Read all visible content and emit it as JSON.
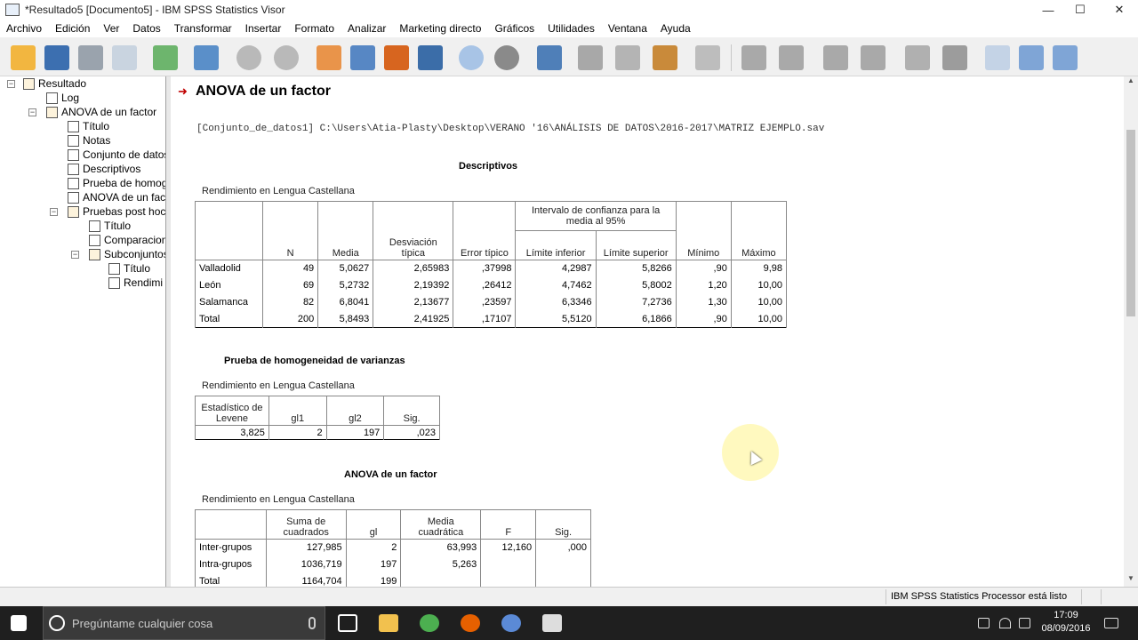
{
  "window": {
    "title": "*Resultado5 [Documento5] - IBM SPSS Statistics Visor",
    "minimize": "—",
    "maximize": "☐",
    "close": "✕"
  },
  "menu": [
    "Archivo",
    "Edición",
    "Ver",
    "Datos",
    "Transformar",
    "Insertar",
    "Formato",
    "Analizar",
    "Marketing directo",
    "Gráficos",
    "Utilidades",
    "Ventana",
    "Ayuda"
  ],
  "toolbar_icons": [
    "open-icon",
    "save-icon",
    "print-icon",
    "print-preview-icon",
    "export-icon",
    "recall-dialog-icon",
    "undo-icon",
    "redo-icon",
    "goto-data-icon",
    "goto-case-icon",
    "goto-variable-icon",
    "variables-icon",
    "analysis-icon",
    "chart-icon",
    "select-cases-icon",
    "designate-window-icon",
    "cut-icon",
    "copy-icon",
    "paste-icon",
    "text-icon",
    "back-arrow-icon",
    "forward-arrow-icon",
    "expand-icon",
    "collapse-icon",
    "show-icon",
    "hide-icon",
    "insert-heading-icon",
    "insert-title-icon",
    "insert-text-icon"
  ],
  "tree": [
    {
      "label": "Resultado",
      "depth": 0
    },
    {
      "label": "Log",
      "depth": 1
    },
    {
      "label": "ANOVA de un factor",
      "depth": 1
    },
    {
      "label": "Título",
      "depth": 2
    },
    {
      "label": "Notas",
      "depth": 2
    },
    {
      "label": "Conjunto de datos",
      "depth": 2
    },
    {
      "label": "Descriptivos",
      "depth": 2
    },
    {
      "label": "Prueba de homog",
      "depth": 2
    },
    {
      "label": "ANOVA de un facto",
      "depth": 2
    },
    {
      "label": "Pruebas post hoc",
      "depth": 2
    },
    {
      "label": "Título",
      "depth": 3
    },
    {
      "label": "Comparacion",
      "depth": 3
    },
    {
      "label": "Subconjuntos",
      "depth": 3
    },
    {
      "label": "Título",
      "depth": 4
    },
    {
      "label": "Rendimi",
      "depth": 4
    }
  ],
  "output": {
    "heading": "ANOVA de un factor",
    "dataset_path": "[Conjunto_de_datos1] C:\\Users\\Atia-Plasty\\Desktop\\VERANO '16\\ANÁLISIS DE DATOS\\2016-2017\\MATRIZ EJEMPLO.sav"
  },
  "descriptivos": {
    "title": "Descriptivos",
    "caption": "Rendimiento en Lengua Castellana",
    "group_header": "Intervalo de confianza para la media al 95%",
    "headers": [
      "N",
      "Media",
      "Desviación típica",
      "Error típico",
      "Límite inferior",
      "Límite superior",
      "Mínimo",
      "Máximo"
    ],
    "rows": [
      [
        "Valladolid",
        "49",
        "5,0627",
        "2,65983",
        ",37998",
        "4,2987",
        "5,8266",
        ",90",
        "9,98"
      ],
      [
        "León",
        "69",
        "5,2732",
        "2,19392",
        ",26412",
        "4,7462",
        "5,8002",
        "1,20",
        "10,00"
      ],
      [
        "Salamanca",
        "82",
        "6,8041",
        "2,13677",
        ",23597",
        "6,3346",
        "7,2736",
        "1,30",
        "10,00"
      ],
      [
        "Total",
        "200",
        "5,8493",
        "2,41925",
        ",17107",
        "5,5120",
        "6,1866",
        ",90",
        "10,00"
      ]
    ]
  },
  "homogeneidad": {
    "title": "Prueba de homogeneidad de varianzas",
    "caption": "Rendimiento en Lengua Castellana",
    "headers": [
      "Estadístico de Levene",
      "gl1",
      "gl2",
      "Sig."
    ],
    "row": [
      "3,825",
      "2",
      "197",
      ",023"
    ]
  },
  "anova": {
    "title": "ANOVA de un factor",
    "caption": "Rendimiento en Lengua Castellana",
    "headers": [
      "Suma de cuadrados",
      "gl",
      "Media cuadrática",
      "F",
      "Sig."
    ],
    "rows": [
      [
        "Inter-grupos",
        "127,985",
        "2",
        "63,993",
        "12,160",
        ",000"
      ],
      [
        "Intra-grupos",
        "1036,719",
        "197",
        "5,263",
        "",
        ""
      ],
      [
        "Total",
        "1164,704",
        "199",
        "",
        "",
        ""
      ]
    ]
  },
  "status": {
    "processor": "IBM SPSS Statistics Processor está listo"
  },
  "taskbar": {
    "search_placeholder": "Pregúntame cualquier cosa",
    "time": "17:09",
    "date": "08/09/2016"
  }
}
